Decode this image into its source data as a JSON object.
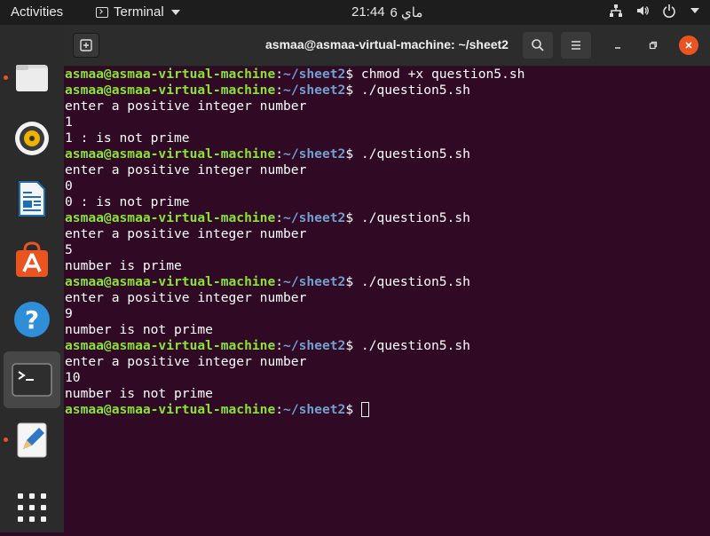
{
  "topbar": {
    "activities": "Activities",
    "app_name": "Terminal",
    "clock_day": "ماي 6",
    "clock_time": "21:44"
  },
  "dock": {
    "items": [
      "files",
      "rhythmbox",
      "libreoffice-writer",
      "ubuntu-software",
      "help",
      "terminal",
      "text-editor",
      "show-applications"
    ]
  },
  "window": {
    "title": "asmaa@asmaa-virtual-machine: ~/sheet2"
  },
  "terminal": {
    "user_host": "asmaa@asmaa-virtual-machine",
    "colon": ":",
    "path": "~/sheet2",
    "prompt_end": "$ ",
    "lines": [
      {
        "prompt": true,
        "text": "chmod +x question5.sh"
      },
      {
        "prompt": true,
        "text": "./question5.sh"
      },
      {
        "prompt": false,
        "text": "enter a positive integer number"
      },
      {
        "prompt": false,
        "text": "1"
      },
      {
        "prompt": false,
        "text": "1 : is not prime"
      },
      {
        "prompt": true,
        "text": "./question5.sh"
      },
      {
        "prompt": false,
        "text": "enter a positive integer number"
      },
      {
        "prompt": false,
        "text": "0"
      },
      {
        "prompt": false,
        "text": "0 : is not prime"
      },
      {
        "prompt": true,
        "text": "./question5.sh"
      },
      {
        "prompt": false,
        "text": "enter a positive integer number"
      },
      {
        "prompt": false,
        "text": "5"
      },
      {
        "prompt": false,
        "text": "number is prime"
      },
      {
        "prompt": true,
        "text": "./question5.sh"
      },
      {
        "prompt": false,
        "text": "enter a positive integer number"
      },
      {
        "prompt": false,
        "text": "9"
      },
      {
        "prompt": false,
        "text": "number is not prime"
      },
      {
        "prompt": true,
        "text": "./question5.sh"
      },
      {
        "prompt": false,
        "text": "enter a positive integer number"
      },
      {
        "prompt": false,
        "text": "10"
      },
      {
        "prompt": false,
        "text": "number is not prime"
      },
      {
        "prompt": true,
        "text": "",
        "cursor": true
      }
    ]
  },
  "colors": {
    "terminal_bg": "#300a24",
    "user_host": "#8ae234",
    "path": "#729fcf",
    "accent": "#e95420"
  }
}
